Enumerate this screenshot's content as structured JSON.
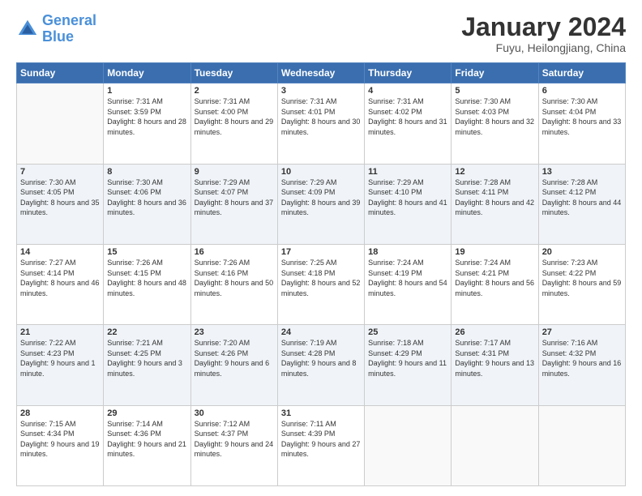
{
  "header": {
    "logo_general": "General",
    "logo_blue": "Blue",
    "month": "January 2024",
    "location": "Fuyu, Heilongjiang, China"
  },
  "days_of_week": [
    "Sunday",
    "Monday",
    "Tuesday",
    "Wednesday",
    "Thursday",
    "Friday",
    "Saturday"
  ],
  "weeks": [
    [
      {
        "day": "",
        "sunrise": "",
        "sunset": "",
        "daylight": ""
      },
      {
        "day": "1",
        "sunrise": "Sunrise: 7:31 AM",
        "sunset": "Sunset: 3:59 PM",
        "daylight": "Daylight: 8 hours and 28 minutes."
      },
      {
        "day": "2",
        "sunrise": "Sunrise: 7:31 AM",
        "sunset": "Sunset: 4:00 PM",
        "daylight": "Daylight: 8 hours and 29 minutes."
      },
      {
        "day": "3",
        "sunrise": "Sunrise: 7:31 AM",
        "sunset": "Sunset: 4:01 PM",
        "daylight": "Daylight: 8 hours and 30 minutes."
      },
      {
        "day": "4",
        "sunrise": "Sunrise: 7:31 AM",
        "sunset": "Sunset: 4:02 PM",
        "daylight": "Daylight: 8 hours and 31 minutes."
      },
      {
        "day": "5",
        "sunrise": "Sunrise: 7:30 AM",
        "sunset": "Sunset: 4:03 PM",
        "daylight": "Daylight: 8 hours and 32 minutes."
      },
      {
        "day": "6",
        "sunrise": "Sunrise: 7:30 AM",
        "sunset": "Sunset: 4:04 PM",
        "daylight": "Daylight: 8 hours and 33 minutes."
      }
    ],
    [
      {
        "day": "7",
        "sunrise": "Sunrise: 7:30 AM",
        "sunset": "Sunset: 4:05 PM",
        "daylight": "Daylight: 8 hours and 35 minutes."
      },
      {
        "day": "8",
        "sunrise": "Sunrise: 7:30 AM",
        "sunset": "Sunset: 4:06 PM",
        "daylight": "Daylight: 8 hours and 36 minutes."
      },
      {
        "day": "9",
        "sunrise": "Sunrise: 7:29 AM",
        "sunset": "Sunset: 4:07 PM",
        "daylight": "Daylight: 8 hours and 37 minutes."
      },
      {
        "day": "10",
        "sunrise": "Sunrise: 7:29 AM",
        "sunset": "Sunset: 4:09 PM",
        "daylight": "Daylight: 8 hours and 39 minutes."
      },
      {
        "day": "11",
        "sunrise": "Sunrise: 7:29 AM",
        "sunset": "Sunset: 4:10 PM",
        "daylight": "Daylight: 8 hours and 41 minutes."
      },
      {
        "day": "12",
        "sunrise": "Sunrise: 7:28 AM",
        "sunset": "Sunset: 4:11 PM",
        "daylight": "Daylight: 8 hours and 42 minutes."
      },
      {
        "day": "13",
        "sunrise": "Sunrise: 7:28 AM",
        "sunset": "Sunset: 4:12 PM",
        "daylight": "Daylight: 8 hours and 44 minutes."
      }
    ],
    [
      {
        "day": "14",
        "sunrise": "Sunrise: 7:27 AM",
        "sunset": "Sunset: 4:14 PM",
        "daylight": "Daylight: 8 hours and 46 minutes."
      },
      {
        "day": "15",
        "sunrise": "Sunrise: 7:26 AM",
        "sunset": "Sunset: 4:15 PM",
        "daylight": "Daylight: 8 hours and 48 minutes."
      },
      {
        "day": "16",
        "sunrise": "Sunrise: 7:26 AM",
        "sunset": "Sunset: 4:16 PM",
        "daylight": "Daylight: 8 hours and 50 minutes."
      },
      {
        "day": "17",
        "sunrise": "Sunrise: 7:25 AM",
        "sunset": "Sunset: 4:18 PM",
        "daylight": "Daylight: 8 hours and 52 minutes."
      },
      {
        "day": "18",
        "sunrise": "Sunrise: 7:24 AM",
        "sunset": "Sunset: 4:19 PM",
        "daylight": "Daylight: 8 hours and 54 minutes."
      },
      {
        "day": "19",
        "sunrise": "Sunrise: 7:24 AM",
        "sunset": "Sunset: 4:21 PM",
        "daylight": "Daylight: 8 hours and 56 minutes."
      },
      {
        "day": "20",
        "sunrise": "Sunrise: 7:23 AM",
        "sunset": "Sunset: 4:22 PM",
        "daylight": "Daylight: 8 hours and 59 minutes."
      }
    ],
    [
      {
        "day": "21",
        "sunrise": "Sunrise: 7:22 AM",
        "sunset": "Sunset: 4:23 PM",
        "daylight": "Daylight: 9 hours and 1 minute."
      },
      {
        "day": "22",
        "sunrise": "Sunrise: 7:21 AM",
        "sunset": "Sunset: 4:25 PM",
        "daylight": "Daylight: 9 hours and 3 minutes."
      },
      {
        "day": "23",
        "sunrise": "Sunrise: 7:20 AM",
        "sunset": "Sunset: 4:26 PM",
        "daylight": "Daylight: 9 hours and 6 minutes."
      },
      {
        "day": "24",
        "sunrise": "Sunrise: 7:19 AM",
        "sunset": "Sunset: 4:28 PM",
        "daylight": "Daylight: 9 hours and 8 minutes."
      },
      {
        "day": "25",
        "sunrise": "Sunrise: 7:18 AM",
        "sunset": "Sunset: 4:29 PM",
        "daylight": "Daylight: 9 hours and 11 minutes."
      },
      {
        "day": "26",
        "sunrise": "Sunrise: 7:17 AM",
        "sunset": "Sunset: 4:31 PM",
        "daylight": "Daylight: 9 hours and 13 minutes."
      },
      {
        "day": "27",
        "sunrise": "Sunrise: 7:16 AM",
        "sunset": "Sunset: 4:32 PM",
        "daylight": "Daylight: 9 hours and 16 minutes."
      }
    ],
    [
      {
        "day": "28",
        "sunrise": "Sunrise: 7:15 AM",
        "sunset": "Sunset: 4:34 PM",
        "daylight": "Daylight: 9 hours and 19 minutes."
      },
      {
        "day": "29",
        "sunrise": "Sunrise: 7:14 AM",
        "sunset": "Sunset: 4:36 PM",
        "daylight": "Daylight: 9 hours and 21 minutes."
      },
      {
        "day": "30",
        "sunrise": "Sunrise: 7:12 AM",
        "sunset": "Sunset: 4:37 PM",
        "daylight": "Daylight: 9 hours and 24 minutes."
      },
      {
        "day": "31",
        "sunrise": "Sunrise: 7:11 AM",
        "sunset": "Sunset: 4:39 PM",
        "daylight": "Daylight: 9 hours and 27 minutes."
      },
      {
        "day": "",
        "sunrise": "",
        "sunset": "",
        "daylight": ""
      },
      {
        "day": "",
        "sunrise": "",
        "sunset": "",
        "daylight": ""
      },
      {
        "day": "",
        "sunrise": "",
        "sunset": "",
        "daylight": ""
      }
    ]
  ]
}
